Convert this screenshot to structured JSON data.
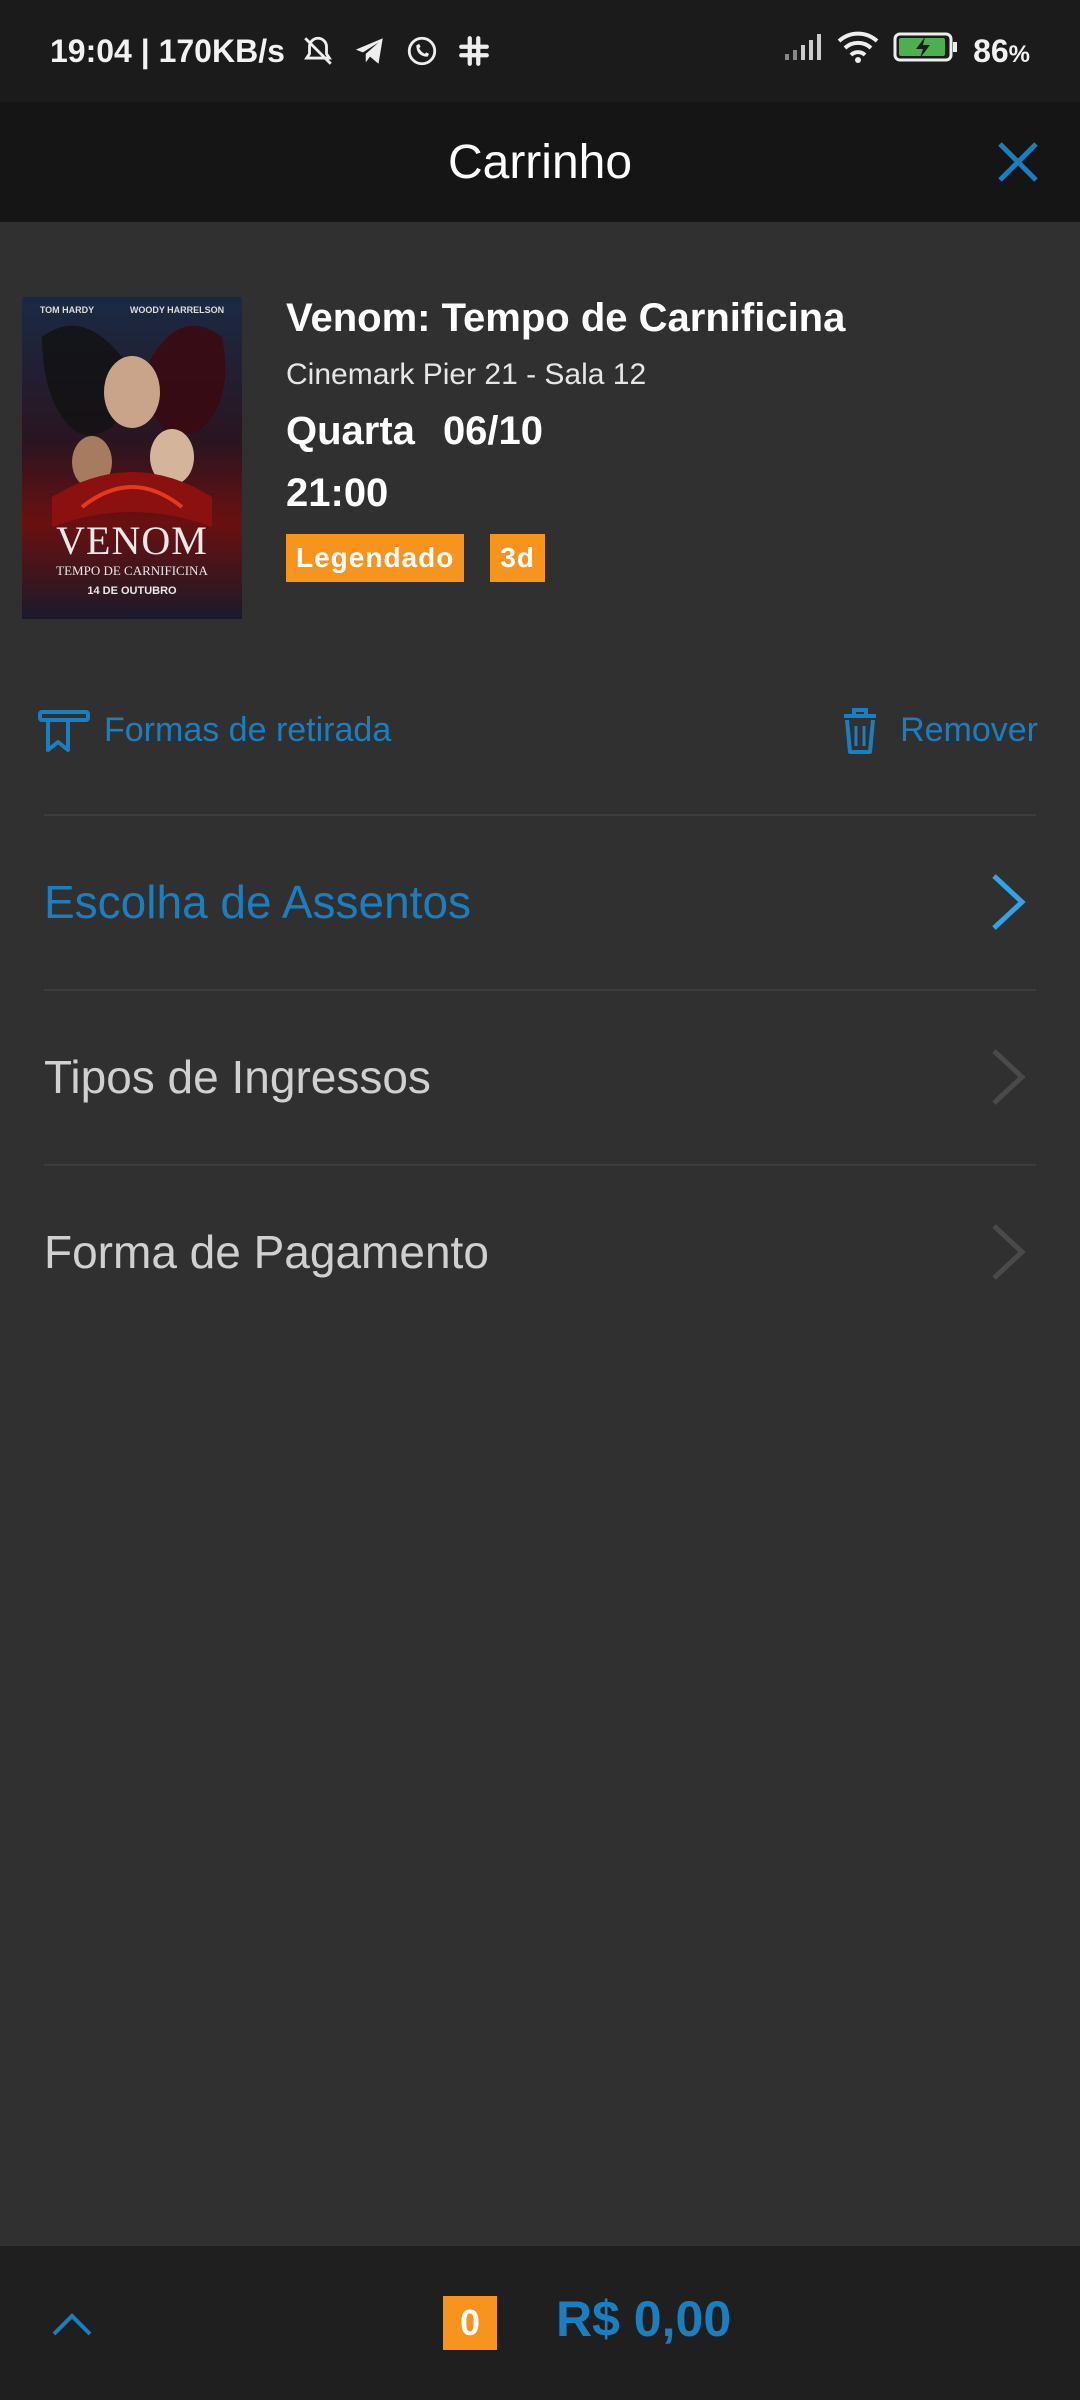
{
  "status_bar": {
    "time_speed": "19:04 | 170KB/s",
    "battery_pct": "86",
    "battery_unit": "%",
    "icons": [
      "mute-bell-icon",
      "telegram-icon",
      "whatsapp-icon",
      "slack-icon",
      "signal-icon",
      "wifi-icon",
      "battery-charging-icon"
    ]
  },
  "header": {
    "title": "Carrinho",
    "close_icon": "close-icon",
    "accent_color": "#1a7fc1"
  },
  "movie": {
    "title": "Venom: Tempo de Carnificina",
    "cinema": "Cinemark Pier 21 - Sala 12",
    "weekday": "Quarta",
    "date": "06/10",
    "time": "21:00",
    "badges": [
      "Legendado",
      "3d"
    ],
    "badge_color": "#f7941d",
    "poster": {
      "title": "VENOM",
      "subtitle": "TEMPO DE CARNIFICINA",
      "date_text": "14 DE OUTUBRO",
      "actors": [
        "TOM HARDY",
        "WOODY HARRELSON"
      ]
    }
  },
  "actions": {
    "pickup_label": "Formas de retirada",
    "remove_label": "Remover"
  },
  "steps": [
    {
      "label": "Escolha de Assentos",
      "active": true
    },
    {
      "label": "Tipos de Ingressos",
      "active": false
    },
    {
      "label": "Forma de Pagamento",
      "active": false
    }
  ],
  "footer": {
    "count": "0",
    "total": "R$ 0,00",
    "expand_icon": "chevron-up-icon"
  }
}
